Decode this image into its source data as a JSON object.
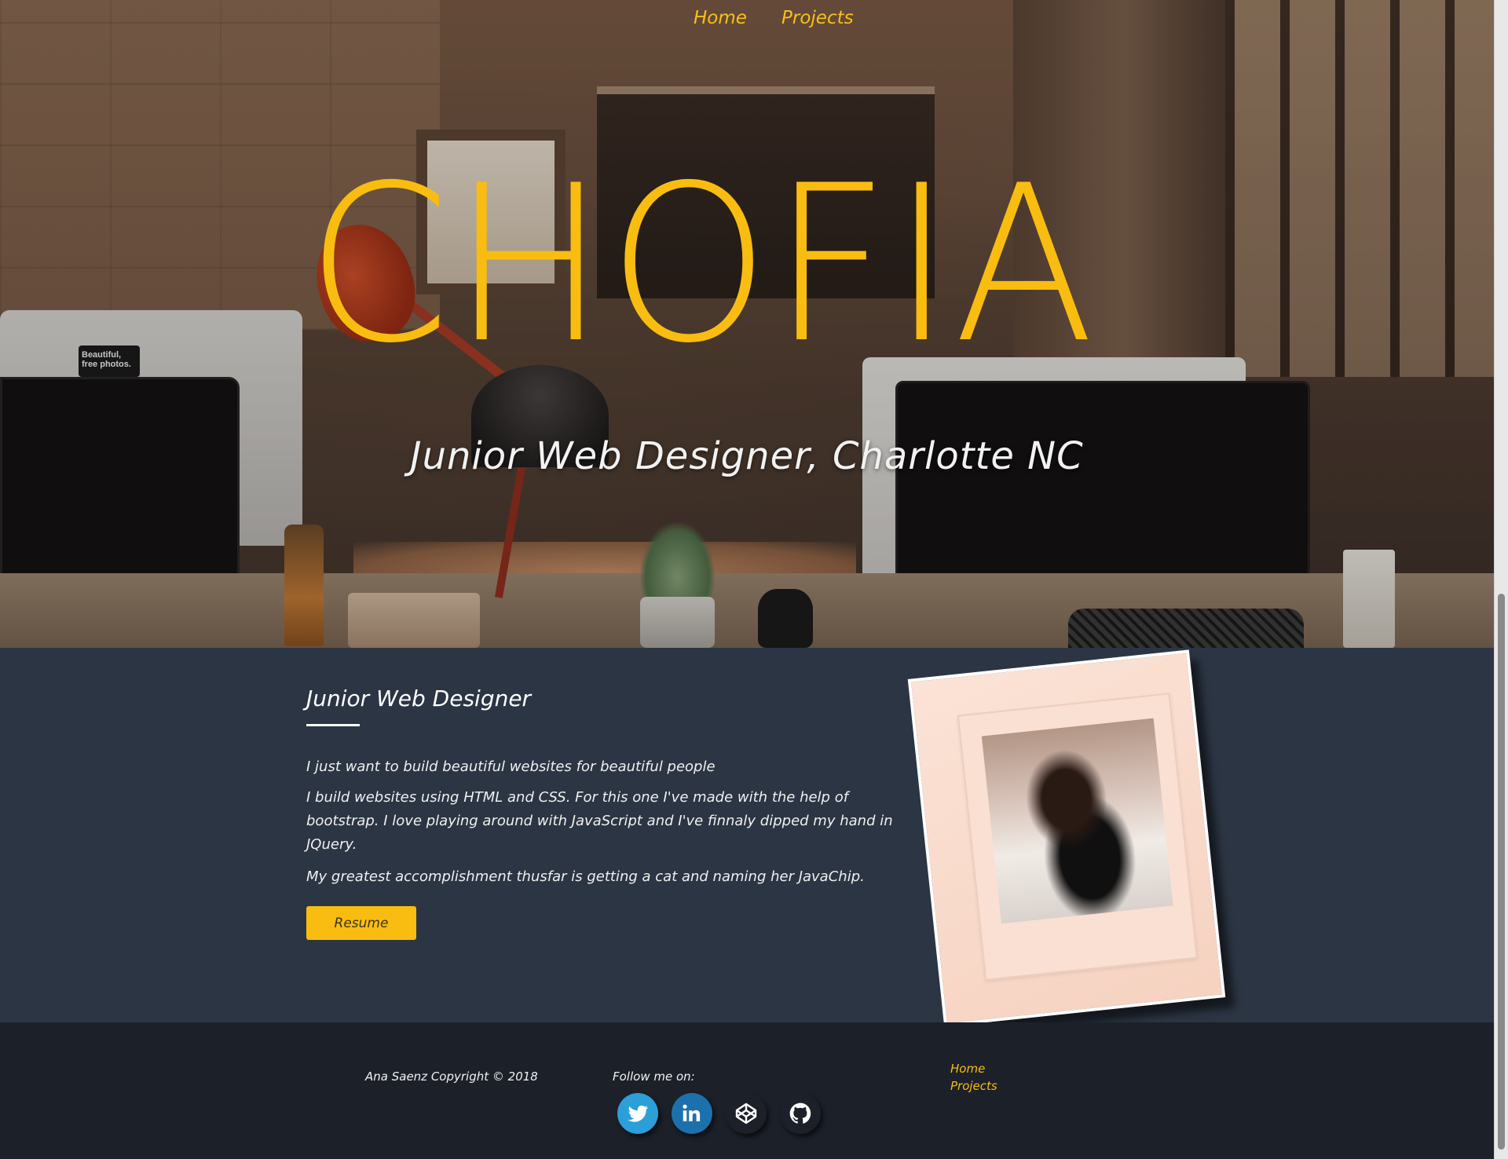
{
  "nav": {
    "home": "Home",
    "projects": "Projects"
  },
  "hero": {
    "title": "CHOFIA",
    "subtitle": "Junior Web Designer, Charlotte NC",
    "sticker_text": "Beautiful, free photos."
  },
  "about": {
    "heading": "Junior Web Designer",
    "p1": "I just want to build beautiful websites for beautiful people",
    "p2": "I build websites using HTML and CSS. For this one I've made with the help of bootstrap. I love playing around with JavaScript and I've finnaly dipped my hand in JQuery.",
    "p3": "My greatest accomplishment thusfar is getting a cat and naming her JavaChip.",
    "resume_label": "Resume"
  },
  "footer": {
    "copyright": "Ana Saenz Copyright © 2018",
    "follow_label": "Follow me on:",
    "social": [
      "twitter",
      "linkedin",
      "codepen",
      "github"
    ],
    "links": {
      "home": "Home",
      "projects": "Projects"
    }
  },
  "colors": {
    "accent": "#f8bd10",
    "about_bg": "#2c3543",
    "footer_bg": "#1c2029",
    "twitter": "#2c9fd9",
    "linkedin": "#1c71ad"
  }
}
